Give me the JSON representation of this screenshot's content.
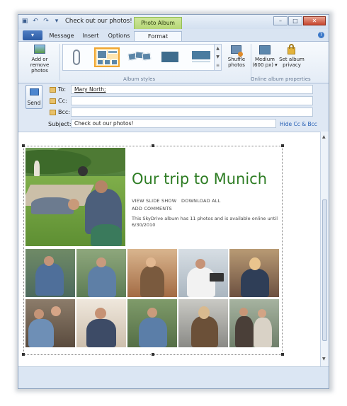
{
  "window": {
    "title": "Check out our photos!",
    "context_tab": "Photo Album Tools",
    "buttons": {
      "minimize": "–",
      "maximize": "□",
      "close": "✕"
    }
  },
  "quick_access": [
    "save-icon",
    "undo-icon",
    "redo-icon",
    "dropdown-icon"
  ],
  "ribbon": {
    "file_label": "▾",
    "tabs": [
      {
        "label": "Message",
        "active": false
      },
      {
        "label": "Insert",
        "active": false
      },
      {
        "label": "Options",
        "active": false
      },
      {
        "label": "Format",
        "active": true
      }
    ],
    "add_remove_label": "Add or remove photos",
    "album_styles_label": "Album styles",
    "shuffle_label": "Shuffle photos",
    "medium_label": "Medium (600 px) ▾",
    "privacy_label": "Set album privacy",
    "online_props_label": "Online album properties"
  },
  "compose_header": {
    "send_label": "Send",
    "to_label": "To:",
    "to_value": "Mary North;",
    "cc_label": "Cc:",
    "bcc_label": "Bcc:",
    "subject_label": "Subject:",
    "subject_value": "Check out our photos!",
    "hide_cc_bcc": "Hide Cc & Bcc"
  },
  "album": {
    "title": "Our trip to Munich",
    "view_slide_show": "VIEW SLIDE SHOW",
    "download_all": "DOWNLOAD ALL",
    "add_comments": "ADD COMMENTS",
    "description": "This SkyDrive album has 11 photos and is available online until 6/30/2010"
  },
  "colors": {
    "accent_green": "#2e7d24",
    "link_blue": "#2760b5",
    "gallery_selected": "#f0a530"
  }
}
